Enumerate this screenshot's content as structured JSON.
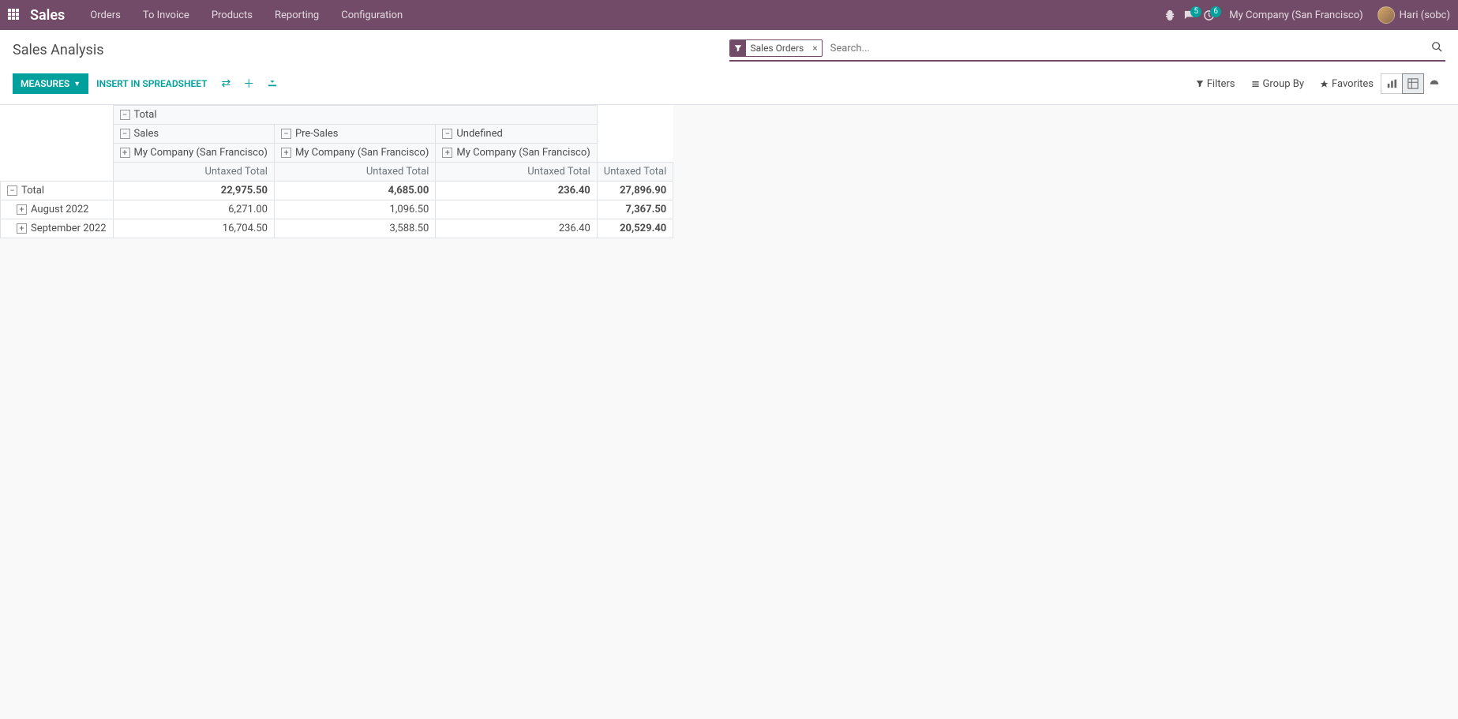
{
  "navbar": {
    "brand": "Sales",
    "menu": [
      "Orders",
      "To Invoice",
      "Products",
      "Reporting",
      "Configuration"
    ],
    "messages_badge": "5",
    "activities_badge": "6",
    "company": "My Company (San Francisco)",
    "user": "Hari (sobc)"
  },
  "controlPanel": {
    "title": "Sales Analysis",
    "measuresBtn": "MEASURES",
    "insertBtn": "INSERT IN SPREADSHEET",
    "searchPlaceholder": "Search...",
    "facet": "Sales Orders",
    "filters": "Filters",
    "groupBy": "Group By",
    "favorites": "Favorites"
  },
  "pivot": {
    "colRoot": "Total",
    "colGroups": [
      "Sales",
      "Pre-Sales",
      "Undefined"
    ],
    "company": "My Company (San Francisco)",
    "measure": "Untaxed Total",
    "rows": [
      {
        "label": "Total",
        "indent": 0,
        "expanded": true,
        "values": [
          "22,975.50",
          "4,685.00",
          "236.40",
          "27,896.90"
        ],
        "bold": true
      },
      {
        "label": "August 2022",
        "indent": 1,
        "expanded": false,
        "values": [
          "6,271.00",
          "1,096.50",
          "",
          "7,367.50"
        ],
        "bold": false
      },
      {
        "label": "September 2022",
        "indent": 1,
        "expanded": false,
        "values": [
          "16,704.50",
          "3,588.50",
          "236.40",
          "20,529.40"
        ],
        "bold": false
      }
    ]
  }
}
